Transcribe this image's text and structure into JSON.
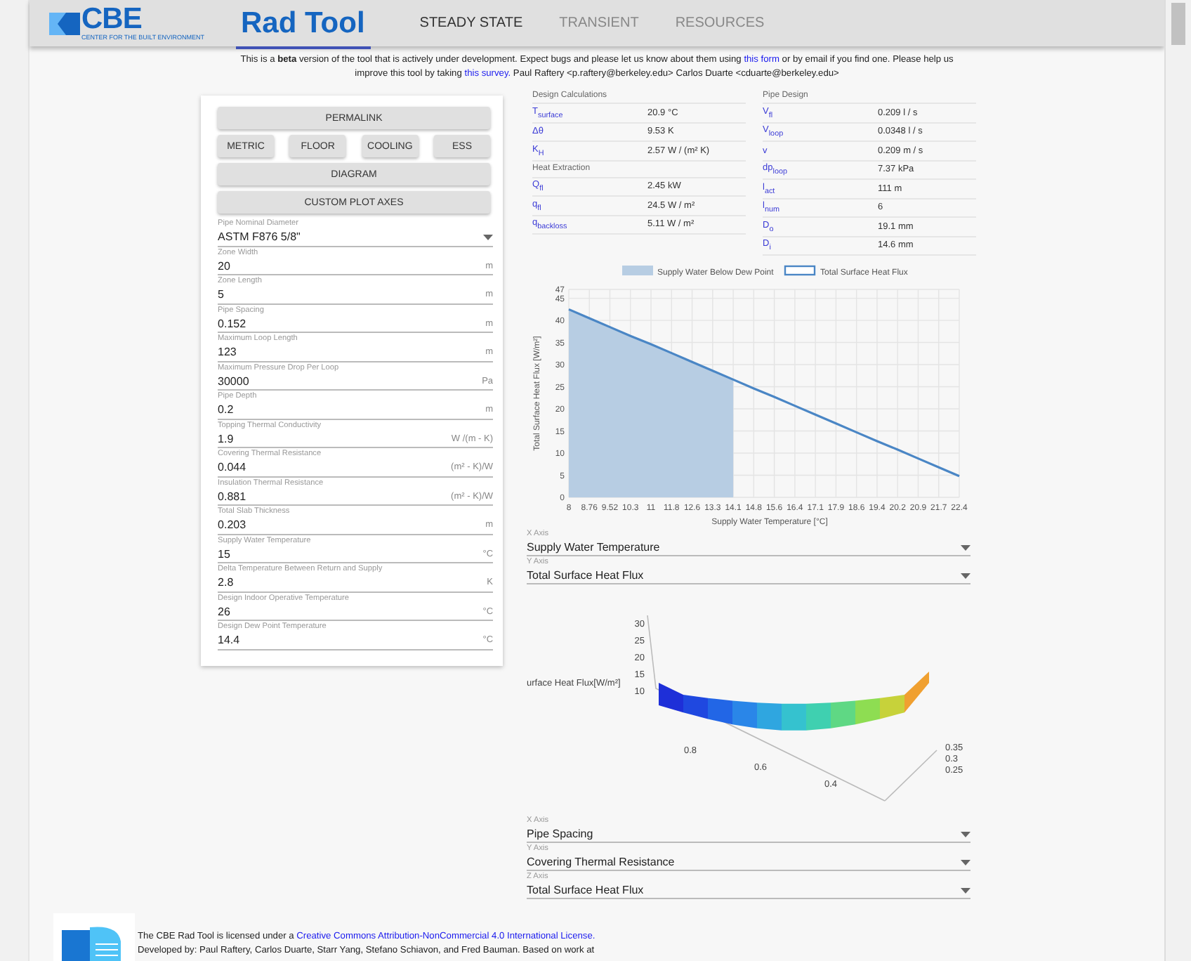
{
  "header": {
    "logo_text": "CBE",
    "logo_subtitle": "CENTER FOR THE BUILT ENVIRONMENT",
    "app_title": "Rad Tool",
    "tabs": [
      {
        "label": "STEADY STATE",
        "selected": true
      },
      {
        "label": "TRANSIENT",
        "selected": false
      },
      {
        "label": "RESOURCES",
        "selected": false
      }
    ]
  },
  "notice": {
    "line_1": "This is a **beta** version of the tool that is actively under development. Expect bugs and please let us know about them using",
    "link_1": "this form",
    "line_1_end": "or by email if you find one. Please help us",
    "line_2": "improve this tool by taking",
    "link_2": "this survey.",
    "line_2_end": "Paul Raftery <p.raftery@berkeley.edu> Carlos Duarte <cduarte@berkeley.edu>"
  },
  "buttons": {
    "permalink": "PERMALINK",
    "row": [
      "METRIC",
      "FLOOR",
      "COOLING",
      "ESS"
    ],
    "diagram": "DIAGRAM",
    "custom_axes": "CUSTOM PLOT AXES"
  },
  "fields": [
    {
      "kind": "select",
      "label": "Pipe Nominal Diameter",
      "value": "ASTM F876 5/8\""
    },
    {
      "kind": "number",
      "label": "Zone Width",
      "value": "20",
      "unit": "m"
    },
    {
      "kind": "number",
      "label": "Zone Length",
      "value": "5",
      "unit": "m"
    },
    {
      "kind": "number",
      "label": "Pipe Spacing",
      "value": "0.152",
      "unit": "m"
    },
    {
      "kind": "number",
      "label": "Maximum Loop Length",
      "value": "123",
      "unit": "m"
    },
    {
      "kind": "number",
      "label": "Maximum Pressure Drop Per Loop",
      "value": "30000",
      "unit": "Pa"
    },
    {
      "kind": "number",
      "label": "Pipe Depth",
      "value": "0.2",
      "unit": "m"
    },
    {
      "kind": "number",
      "label": "Topping Thermal Conductivity",
      "value": "1.9",
      "unit": "W /(m - K)"
    },
    {
      "kind": "number",
      "label": "Covering Thermal Resistance",
      "value": "0.044",
      "unit": "(m² - K)/W"
    },
    {
      "kind": "number",
      "label": "Insulation Thermal Resistance",
      "value": "0.881",
      "unit": "(m² - K)/W"
    },
    {
      "kind": "number",
      "label": "Total Slab Thickness",
      "value": "0.203",
      "unit": "m"
    },
    {
      "kind": "number",
      "label": "Supply Water Temperature",
      "value": "15",
      "unit": "°C"
    },
    {
      "kind": "number",
      "label": "Delta Temperature Between Return and Supply",
      "value": "2.8",
      "unit": "K"
    },
    {
      "kind": "number",
      "label": "Design Indoor Operative Temperature",
      "value": "26",
      "unit": "°C"
    },
    {
      "kind": "number",
      "label": "Design Dew Point Temperature",
      "value": "14.4",
      "unit": "°C"
    }
  ],
  "results": {
    "left": [
      {
        "kind": "heading",
        "label": "Design Calculations"
      },
      {
        "kind": "row",
        "symbol": "T$_{surface}$",
        "value": "20.9 °C"
      },
      {
        "kind": "row",
        "symbol": "Δθ",
        "value": "9.53 K"
      },
      {
        "kind": "row",
        "symbol": "K$_{H}$",
        "value": "2.57 W / (m² K)"
      },
      {
        "kind": "heading",
        "label": "Heat Extraction"
      },
      {
        "kind": "row",
        "symbol": "Q$_{fl}$",
        "value": "2.45 kW"
      },
      {
        "kind": "row",
        "symbol": "q$_{fl}$",
        "value": "24.5 W / m²"
      },
      {
        "kind": "row",
        "symbol": "q$_{backloss}$",
        "value": "5.11 W / m²"
      }
    ],
    "right": [
      {
        "kind": "heading",
        "label": "Pipe Design"
      },
      {
        "kind": "row",
        "symbol": "V$_{fl}$",
        "value": "0.209 l / s"
      },
      {
        "kind": "row",
        "symbol": "V$_{loop}$",
        "value": "0.0348 l / s"
      },
      {
        "kind": "row",
        "symbol": "v",
        "value": "0.209 m / s"
      },
      {
        "kind": "row",
        "symbol": "dp$_{loop}$",
        "value": "7.37 kPa"
      },
      {
        "kind": "row",
        "symbol": "l$_{act}$",
        "value": "111 m"
      },
      {
        "kind": "row",
        "symbol": "l$_{num}$",
        "value": "6"
      },
      {
        "kind": "row",
        "symbol": "D$_{o}$",
        "value": "19.1 mm"
      },
      {
        "kind": "row",
        "symbol": "D$_{i}$",
        "value": "14.6 mm"
      }
    ]
  },
  "line_chart": {
    "chart_data": {
      "type": "line",
      "xlabel": "Supply Water Temperature [°C]",
      "ylabel": "Total Surface Heat Flux [W/m²]",
      "categories": [
        "8",
        "8.76",
        "9.52",
        "10.3",
        "11",
        "11.8",
        "12.6",
        "13.3",
        "14.1",
        "14.8",
        "15.6",
        "16.4",
        "17.1",
        "17.9",
        "18.6",
        "19.4",
        "20.2",
        "20.9",
        "21.7",
        "22.4"
      ],
      "series": [
        {
          "name": "Supply Water Below Dew Point",
          "type": "area",
          "color": "#b7cde3",
          "values": [
            42.5,
            40.5,
            38.5,
            36.5,
            34.6,
            32.6,
            30.6,
            28.6,
            26.6,
            null,
            null,
            null,
            null,
            null,
            null,
            null,
            null,
            null,
            null,
            null
          ]
        },
        {
          "name": "Total Surface Heat Flux",
          "type": "line",
          "color": "#4a86c5",
          "values": [
            42.5,
            40.5,
            38.5,
            36.5,
            34.6,
            32.6,
            30.6,
            28.6,
            26.6,
            24.6,
            22.7,
            20.7,
            18.7,
            16.7,
            14.7,
            12.7,
            10.8,
            8.8,
            6.8,
            4.8
          ]
        }
      ],
      "ylim": [
        0,
        47
      ],
      "grid": true,
      "legend": true,
      "yticks": [
        0,
        5,
        10,
        15,
        20,
        25,
        30,
        35,
        40,
        45,
        47
      ]
    },
    "axes": [
      {
        "label": "X Axis",
        "value": "Supply Water Temperature"
      },
      {
        "label": "Y Axis",
        "value": "Total Surface Heat Flux"
      }
    ]
  },
  "surface_plot": {
    "axis_title": "urface Heat Flux[W/m²]",
    "z_ticks": [
      "30",
      "25",
      "20",
      "15",
      "10"
    ],
    "x_ticks": [
      "0.8",
      "0.6",
      "0.4"
    ],
    "y_ticks": [
      "0.35",
      "0.3",
      "0.25"
    ],
    "axes": [
      {
        "label": "X Axis",
        "value": "Pipe Spacing"
      },
      {
        "label": "Y Axis",
        "value": "Covering Thermal Resistance"
      },
      {
        "label": "Z Axis",
        "value": "Total Surface Heat Flux"
      }
    ]
  },
  "footer": {
    "text": "The CBE Rad Tool is licensed under a",
    "link": "Creative Commons Attribution-NonCommercial 4.0 International License.",
    "line_2": "Developed by: Paul Raftery, Carlos Duarte, Starr Yang, Stefano Schiavon, and Fred Bauman. Based on work at"
  }
}
